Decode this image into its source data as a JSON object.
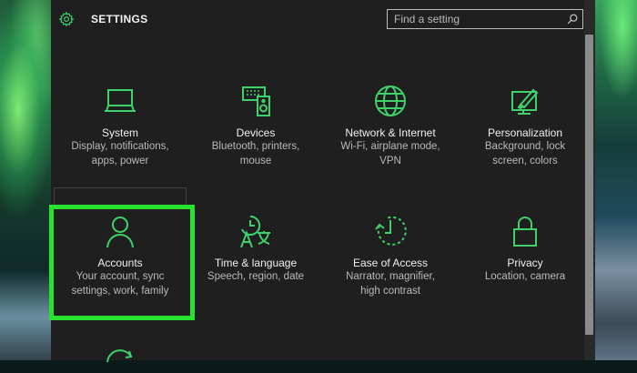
{
  "header": {
    "title": "SETTINGS",
    "search_placeholder": "Find a setting",
    "settings_icon": "gear-icon",
    "search_icon": "search-icon"
  },
  "tiles": [
    {
      "label": "System",
      "desc1": "Display, notifications,",
      "desc2": "apps, power",
      "icon": "laptop-icon"
    },
    {
      "label": "Devices",
      "desc1": "Bluetooth, printers,",
      "desc2": "mouse",
      "icon": "keyboard-speaker-icon"
    },
    {
      "label": "Network & Internet",
      "desc1": "Wi-Fi, airplane mode,",
      "desc2": "VPN",
      "icon": "globe-icon"
    },
    {
      "label": "Personalization",
      "desc1": "Background, lock",
      "desc2": "screen, colors",
      "icon": "paint-icon"
    },
    {
      "label": "Accounts",
      "desc1": "Your account, sync",
      "desc2": "settings, work, family",
      "icon": "person-icon"
    },
    {
      "label": "Time & language",
      "desc1": "Speech, region, date",
      "desc2": "",
      "icon": "time-language-icon"
    },
    {
      "label": "Ease of Access",
      "desc1": "Narrator, magnifier,",
      "desc2": "high contrast",
      "icon": "ease-of-access-icon"
    },
    {
      "label": "Privacy",
      "desc1": "Location, camera",
      "desc2": "",
      "icon": "lock-icon"
    }
  ],
  "colors": {
    "accent": "#3fd16a",
    "highlight": "#27e22e",
    "window_bg": "#1f1f1f"
  }
}
